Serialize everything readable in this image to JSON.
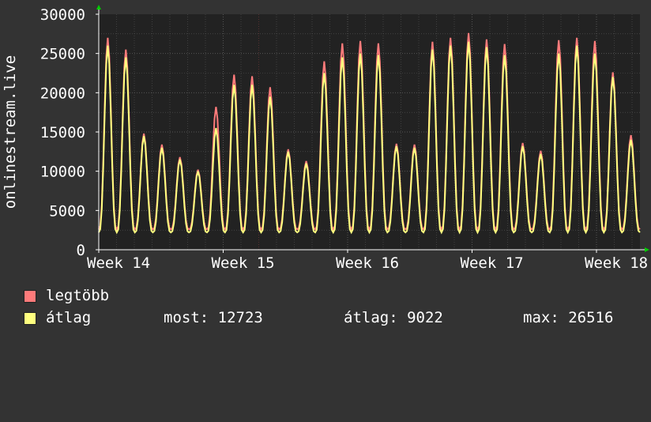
{
  "colors": {
    "background": "#333333",
    "plot_background": "#222222",
    "grid": "#555555",
    "text": "#ffffff",
    "max_series": "#ff7b7b",
    "avg_series": "#ffff7f",
    "arrow": "#00cc00"
  },
  "chart_data": {
    "type": "line",
    "ylabel": "onlinestream.live",
    "ylim": [
      0,
      30000
    ],
    "y_ticks": [
      "0",
      "5000",
      "10000",
      "15000",
      "20000",
      "25000",
      "30000"
    ],
    "x_ticks": [
      "Week 14",
      "Week 15",
      "Week 16",
      "Week 17",
      "Week 18"
    ],
    "grid": true,
    "legend_placement": "bottom",
    "daily_peaks": [
      {
        "max": 27000,
        "avg": 26000
      },
      {
        "max": 25500,
        "avg": 24500
      },
      {
        "max": 14800,
        "avg": 14500
      },
      {
        "max": 13400,
        "avg": 13000
      },
      {
        "max": 11800,
        "avg": 11500
      },
      {
        "max": 10200,
        "avg": 10000
      },
      {
        "max": 18200,
        "avg": 15500
      },
      {
        "max": 22300,
        "avg": 21000
      },
      {
        "max": 22100,
        "avg": 21000
      },
      {
        "max": 20700,
        "avg": 19500
      },
      {
        "max": 12800,
        "avg": 12500
      },
      {
        "max": 11300,
        "avg": 11000
      },
      {
        "max": 24000,
        "avg": 22500
      },
      {
        "max": 26300,
        "avg": 24500
      },
      {
        "max": 26600,
        "avg": 25000
      },
      {
        "max": 26300,
        "avg": 24800
      },
      {
        "max": 13500,
        "avg": 13200
      },
      {
        "max": 13400,
        "avg": 13000
      },
      {
        "max": 26500,
        "avg": 25500
      },
      {
        "max": 27000,
        "avg": 26000
      },
      {
        "max": 27600,
        "avg": 26500
      },
      {
        "max": 26800,
        "avg": 25800
      },
      {
        "max": 26200,
        "avg": 24800
      },
      {
        "max": 13600,
        "avg": 13200
      },
      {
        "max": 12600,
        "avg": 12200
      },
      {
        "max": 26700,
        "avg": 25000
      },
      {
        "max": 27000,
        "avg": 26000
      },
      {
        "max": 26600,
        "avg": 25000
      },
      {
        "max": 22600,
        "avg": 22000
      },
      {
        "max": 14600,
        "avg": 14000
      }
    ],
    "series": [
      {
        "name": "legtöbb",
        "color": "#ff7b7b"
      },
      {
        "name": "átlag",
        "color": "#ffff7f"
      }
    ]
  },
  "legend": {
    "max_label": "legtöbb",
    "avg_label": "átlag"
  },
  "stats": {
    "now": "most: 12723",
    "avg": "átlag: 9022",
    "max": "max: 26516"
  }
}
